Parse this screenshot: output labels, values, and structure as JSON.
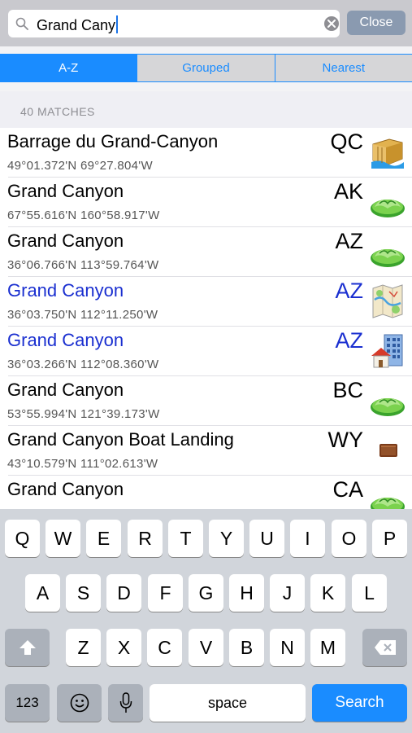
{
  "search": {
    "value": "Grand Cany",
    "close_label": "Close"
  },
  "segments": [
    {
      "label": "A-Z",
      "active": true
    },
    {
      "label": "Grouped",
      "active": false
    },
    {
      "label": "Nearest",
      "active": false
    }
  ],
  "matches_label": "40 MATCHES",
  "results": [
    {
      "name": "Barrage du Grand-Canyon",
      "coords": "49°01.372'N 69°27.804'W",
      "state": "QC",
      "icon": "dam-icon",
      "highlighted": false
    },
    {
      "name": "Grand Canyon",
      "coords": "67°55.616'N 160°58.917'W",
      "state": "AK",
      "icon": "valley-icon",
      "highlighted": false
    },
    {
      "name": "Grand Canyon",
      "coords": "36°06.766'N 113°59.764'W",
      "state": "AZ",
      "icon": "valley-icon",
      "highlighted": false
    },
    {
      "name": "Grand Canyon",
      "coords": "36°03.750'N 112°11.250'W",
      "state": "AZ",
      "icon": "map-icon",
      "highlighted": true
    },
    {
      "name": "Grand Canyon",
      "coords": "36°03.266'N 112°08.360'W",
      "state": "AZ",
      "icon": "town-icon",
      "highlighted": true
    },
    {
      "name": "Grand Canyon",
      "coords": "53°55.994'N 121°39.173'W",
      "state": "BC",
      "icon": "valley-icon",
      "highlighted": false
    },
    {
      "name": "Grand Canyon Boat Landing",
      "coords": "43°10.579'N 111°02.613'W",
      "state": "WY",
      "icon": "boat-landing-icon",
      "highlighted": false
    },
    {
      "name": "Grand Canyon",
      "coords": "",
      "state": "CA",
      "icon": "valley-icon",
      "highlighted": false
    }
  ],
  "keyboard": {
    "row1": [
      "Q",
      "W",
      "E",
      "R",
      "T",
      "Y",
      "U",
      "I",
      "O",
      "P"
    ],
    "row2": [
      "A",
      "S",
      "D",
      "F",
      "G",
      "H",
      "J",
      "K",
      "L"
    ],
    "row3": [
      "Z",
      "X",
      "C",
      "V",
      "B",
      "N",
      "M"
    ],
    "numbers_label": "123",
    "space_label": "space",
    "search_label": "Search"
  }
}
